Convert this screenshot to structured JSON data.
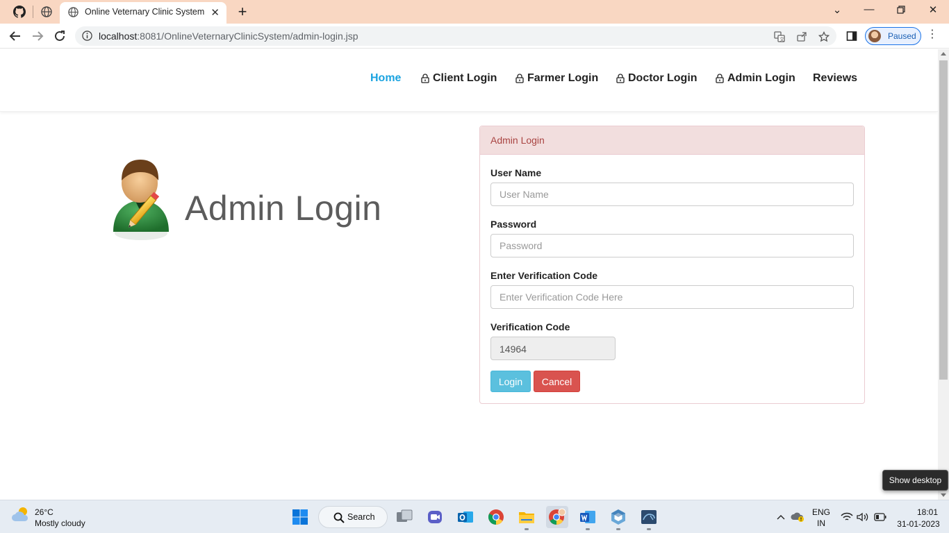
{
  "browser": {
    "active_tab_title": "Online Veternary Clinic System",
    "url_host": "localhost",
    "url_rest": ":8081/OnlineVeternaryClinicSystem/admin-login.jsp",
    "profile_label": "Paused"
  },
  "site": {
    "nav": [
      {
        "label": "Home",
        "active": true,
        "lock": false
      },
      {
        "label": "Client Login",
        "active": false,
        "lock": true
      },
      {
        "label": "Farmer Login",
        "active": false,
        "lock": true
      },
      {
        "label": "Doctor Login",
        "active": false,
        "lock": true
      },
      {
        "label": "Admin Login",
        "active": false,
        "lock": true
      },
      {
        "label": "Reviews",
        "active": false,
        "lock": false
      }
    ],
    "hero_title": "Admin Login",
    "accent_color": "#1aa3e0"
  },
  "form": {
    "heading": "Admin Login",
    "username_label": "User Name",
    "username_placeholder": "User Name",
    "password_label": "Password",
    "password_placeholder": "Password",
    "verify_label": "Enter Verification Code",
    "verify_placeholder": "Enter Verification Code Here",
    "code_label": "Verification Code",
    "code_value": "14964",
    "login_button": "Login",
    "cancel_button": "Cancel",
    "colors": {
      "login": "#5bc0de",
      "cancel": "#d9534f",
      "heading_bg": "#f2dede",
      "heading_text": "#a94442"
    }
  },
  "tooltip": "Show desktop",
  "taskbar": {
    "weather_temp": "26°C",
    "weather_condition": "Mostly cloudy",
    "search_label": "Search",
    "lang_top": "ENG",
    "lang_bottom": "IN",
    "time": "18:01",
    "date": "31-01-2023"
  }
}
